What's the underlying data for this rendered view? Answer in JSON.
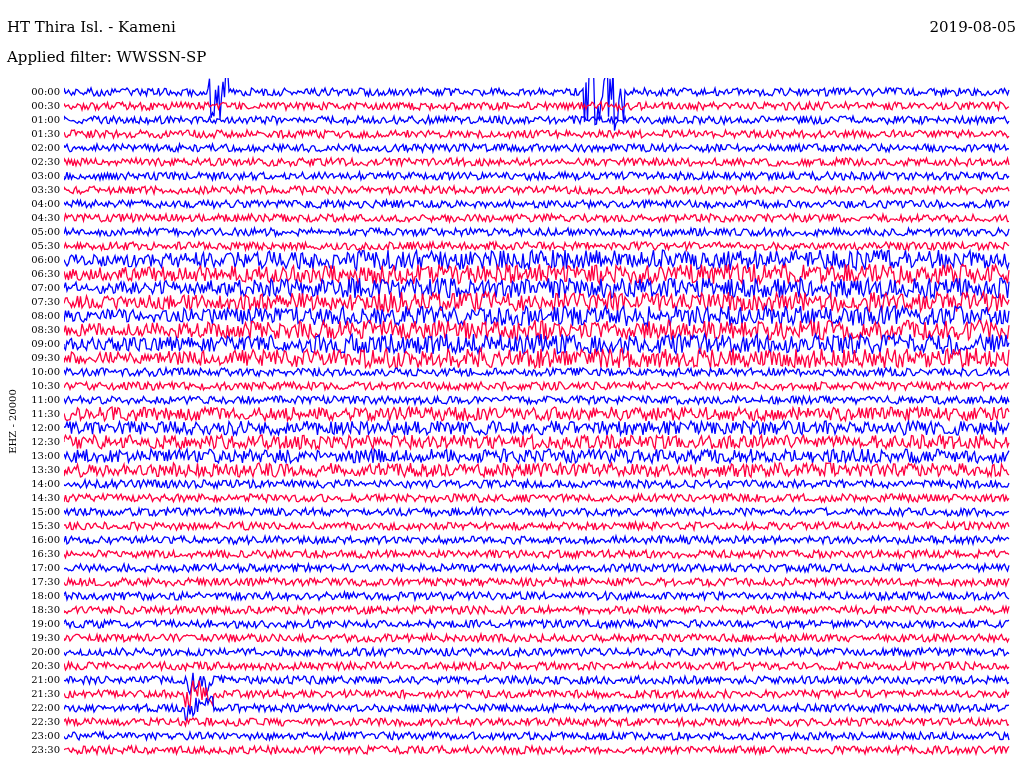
{
  "header": {
    "station": "HT Thira Isl. - Kameni",
    "filter": "Applied filter: WWSSN-SP",
    "date": "2019-08-05"
  },
  "channel_label": "EHZ - 20000",
  "rows": [
    {
      "time": "00:00",
      "color": "#0000ff"
    },
    {
      "time": "00:30",
      "color": "#ff0040"
    },
    {
      "time": "01:00",
      "color": "#0000ff"
    },
    {
      "time": "01:30",
      "color": "#ff0040"
    },
    {
      "time": "02:00",
      "color": "#0000ff"
    },
    {
      "time": "02:30",
      "color": "#ff0040"
    },
    {
      "time": "03:00",
      "color": "#0000ff"
    },
    {
      "time": "03:30",
      "color": "#ff0040"
    },
    {
      "time": "04:00",
      "color": "#0000ff"
    },
    {
      "time": "04:30",
      "color": "#ff0040"
    },
    {
      "time": "05:00",
      "color": "#0000ff"
    },
    {
      "time": "05:30",
      "color": "#ff0040"
    },
    {
      "time": "06:00",
      "color": "#0000ff"
    },
    {
      "time": "06:30",
      "color": "#ff0040"
    },
    {
      "time": "07:00",
      "color": "#0000ff"
    },
    {
      "time": "07:30",
      "color": "#ff0040"
    },
    {
      "time": "08:00",
      "color": "#0000ff"
    },
    {
      "time": "08:30",
      "color": "#ff0040"
    },
    {
      "time": "09:00",
      "color": "#0000ff"
    },
    {
      "time": "09:30",
      "color": "#ff0040"
    },
    {
      "time": "10:00",
      "color": "#0000ff"
    },
    {
      "time": "10:30",
      "color": "#ff0040"
    },
    {
      "time": "11:00",
      "color": "#0000ff"
    },
    {
      "time": "11:30",
      "color": "#ff0040"
    },
    {
      "time": "12:00",
      "color": "#0000ff"
    },
    {
      "time": "12:30",
      "color": "#ff0040"
    },
    {
      "time": "13:00",
      "color": "#0000ff"
    },
    {
      "time": "13:30",
      "color": "#ff0040"
    },
    {
      "time": "14:00",
      "color": "#0000ff"
    },
    {
      "time": "14:30",
      "color": "#ff0040"
    },
    {
      "time": "15:00",
      "color": "#0000ff"
    },
    {
      "time": "15:30",
      "color": "#ff0040"
    },
    {
      "time": "16:00",
      "color": "#0000ff"
    },
    {
      "time": "16:30",
      "color": "#ff0040"
    },
    {
      "time": "17:00",
      "color": "#0000ff"
    },
    {
      "time": "17:30",
      "color": "#ff0040"
    },
    {
      "time": "18:00",
      "color": "#0000ff"
    },
    {
      "time": "18:30",
      "color": "#ff0040"
    },
    {
      "time": "19:00",
      "color": "#0000ff"
    },
    {
      "time": "19:30",
      "color": "#ff0040"
    },
    {
      "time": "20:00",
      "color": "#0000ff"
    },
    {
      "time": "20:30",
      "color": "#ff0040"
    },
    {
      "time": "21:00",
      "color": "#0000ff"
    },
    {
      "time": "21:30",
      "color": "#ff0040"
    },
    {
      "time": "22:00",
      "color": "#0000ff"
    },
    {
      "time": "22:30",
      "color": "#ff0040"
    },
    {
      "time": "23:00",
      "color": "#0000ff"
    },
    {
      "time": "23:30",
      "color": "#ff0040"
    }
  ]
}
